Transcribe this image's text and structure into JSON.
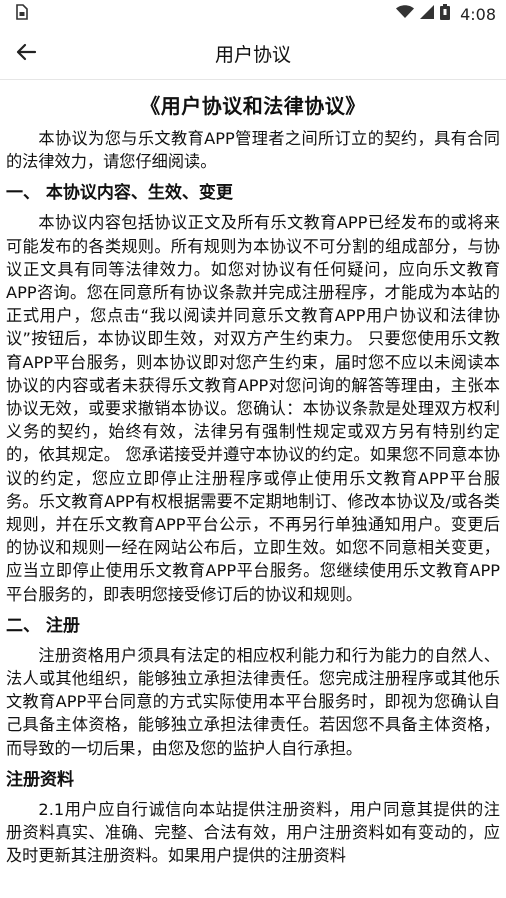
{
  "status_bar": {
    "time": "4:08",
    "icons": [
      "sim-icon",
      "wifi-icon",
      "signal-icon",
      "battery-icon"
    ]
  },
  "app_bar": {
    "title": "用户协议",
    "back_icon": "arrow-left-icon"
  },
  "document": {
    "title": "《用户协议和法律协议》",
    "intro": "本协议为您与乐文教育APP管理者之间所订立的契约，具有合同的法律效力，请您仔细阅读。",
    "section1": {
      "heading": "一、 本协议内容、生效、变更",
      "body": "本协议内容包括协议正文及所有乐文教育APP已经发布的或将来可能发布的各类规则。所有规则为本协议不可分割的组成部分，与协议正文具有同等法律效力。如您对协议有任何疑问，应向乐文教育APP咨询。您在同意所有协议条款并完成注册程序，才能成为本站的正式用户，您点击“我以阅读并同意乐文教育APP用户协议和法律协议”按钮后，本协议即生效，对双方产生约束力。 只要您使用乐文教育APP平台服务，则本协议即对您产生约束，届时您不应以未阅读本协议的内容或者未获得乐文教育APP对您问询的解答等理由，主张本协议无效，或要求撤销本协议。您确认：本协议条款是处理双方权利义务的契约，始终有效，法律另有强制性规定或双方另有特别约定的，依其规定。 您承诺接受并遵守本协议的约定。如果您不同意本协议的约定，您应立即停止注册程序或停止使用乐文教育APP平台服务。乐文教育APP有权根据需要不定期地制订、修改本协议及/或各类规则，并在乐文教育APP平台公示，不再另行单独通知用户。变更后的协议和规则一经在网站公布后，立即生效。如您不同意相关变更，应当立即停止使用乐文教育APP平台服务。您继续使用乐文教育APP平台服务的，即表明您接受修订后的协议和规则。"
    },
    "section2": {
      "heading": "二、 注册",
      "body": "注册资格用户须具有法定的相应权利能力和行为能力的自然人、法人或其他组织，能够独立承担法律责任。您完成注册程序或其他乐文教育APP平台同意的方式实际使用本平台服务时，即视为您确认自己具备主体资格，能够独立承担法律责任。若因您不具备主体资格，而导致的一切后果，由您及您的监护人自行承担。"
    },
    "section3": {
      "heading": "注册资料",
      "body": "2.1用户应自行诚信向本站提供注册资料，用户同意其提供的注册资料真实、准确、完整、合法有效，用户注册资料如有变动的，应及时更新其注册资料。如果用户提供的注册资料"
    }
  }
}
